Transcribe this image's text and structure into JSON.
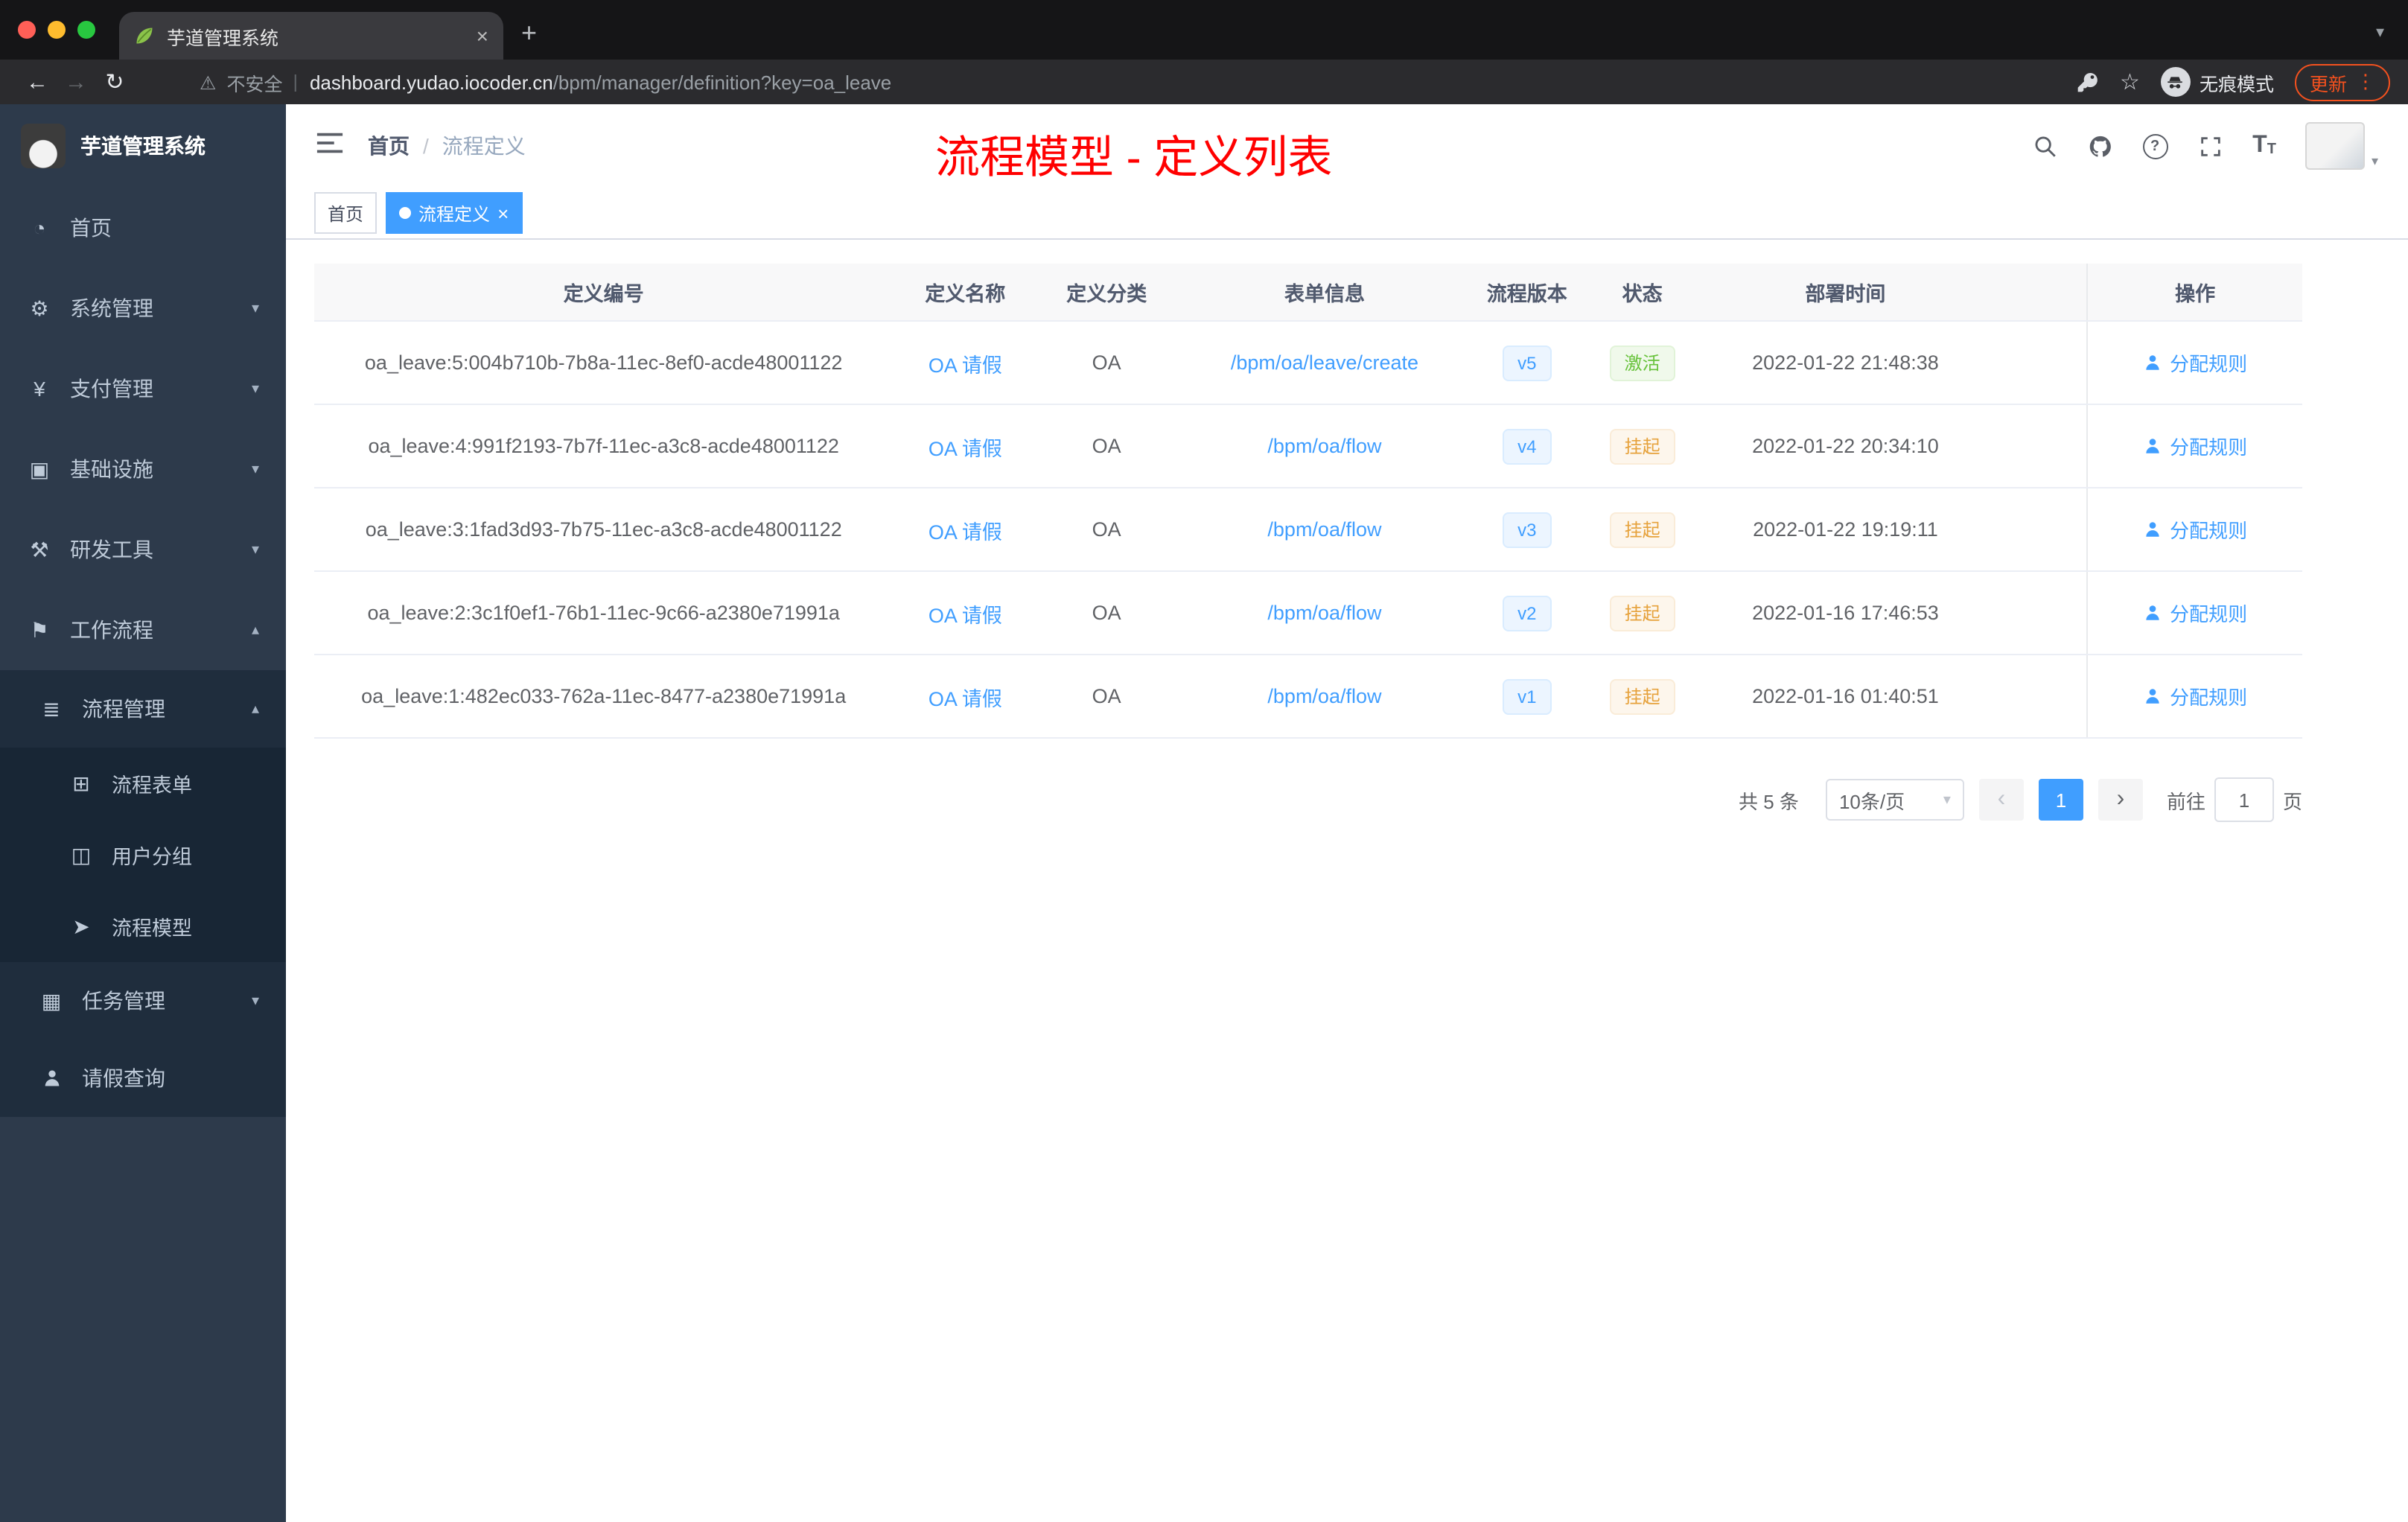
{
  "colors": {
    "accent": "#409eff",
    "success_green": "#67c23a",
    "warning_yellow": "#e6a23c",
    "annotation_red": "#ff0000",
    "update_orange": "#f4511e",
    "sidebar_bg": "#2d3a4b",
    "sidebar_sub_bg": "#1f2d3d"
  },
  "icons": {
    "back": "←",
    "forward": "→",
    "reload": "↻",
    "warning_triangle": "⚠",
    "star": "☆",
    "more_vertical": "⋮",
    "separator": "|",
    "new_tab_plus": "+",
    "tab_close": "×",
    "tabstrip_chevron": "▾",
    "chevron_down": "▾",
    "chevron_up": "▴",
    "question_mark": "?",
    "font_size_large": "T",
    "font_size_small": "T",
    "prev_arrow": "‹",
    "next_arrow": "›",
    "tag_close": "×",
    "breadcrumb_separator": "/",
    "home": "◔",
    "gear": "⚙",
    "yen": "¥",
    "infra": "▣",
    "tools": "⚒",
    "workflow": "⚑",
    "list": "≣",
    "form": "⊞",
    "users": "◫",
    "send": "➤",
    "tasks": "▦"
  },
  "browser": {
    "tab_title": "芋道管理系统",
    "security_label": "不安全",
    "url_host": "dashboard.yudao.iocoder.cn",
    "url_path": "/bpm/manager/definition?key=oa_leave",
    "incognito_label": "无痕模式",
    "update_label": "更新"
  },
  "sidebar": {
    "logo_title": "芋道管理系统",
    "items": [
      {
        "label": "首页"
      },
      {
        "label": "系统管理"
      },
      {
        "label": "支付管理"
      },
      {
        "label": "基础设施"
      },
      {
        "label": "研发工具"
      },
      {
        "label": "工作流程"
      },
      {
        "label": "流程管理"
      },
      {
        "label": "流程表单"
      },
      {
        "label": "用户分组"
      },
      {
        "label": "流程模型"
      },
      {
        "label": "任务管理"
      },
      {
        "label": "请假查询"
      }
    ]
  },
  "header": {
    "breadcrumb": [
      "首页",
      "流程定义"
    ],
    "annotation": "流程模型 - 定义列表"
  },
  "tags": {
    "home": "首页",
    "active": "流程定义"
  },
  "table": {
    "columns": [
      "定义编号",
      "定义名称",
      "定义分类",
      "表单信息",
      "流程版本",
      "状态",
      "部署时间",
      "操作"
    ],
    "rows": [
      {
        "id": "oa_leave:5:004b710b-7b8a-11ec-8ef0-acde48001122",
        "name": "OA 请假",
        "category": "OA",
        "form": "/bpm/oa/leave/create",
        "version": "v5",
        "status": "激活",
        "deploy_time": "2022-01-22 21:48:38",
        "action": "分配规则"
      },
      {
        "id": "oa_leave:4:991f2193-7b7f-11ec-a3c8-acde48001122",
        "name": "OA 请假",
        "category": "OA",
        "form": "/bpm/oa/flow",
        "version": "v4",
        "status": "挂起",
        "deploy_time": "2022-01-22 20:34:10",
        "action": "分配规则"
      },
      {
        "id": "oa_leave:3:1fad3d93-7b75-11ec-a3c8-acde48001122",
        "name": "OA 请假",
        "category": "OA",
        "form": "/bpm/oa/flow",
        "version": "v3",
        "status": "挂起",
        "deploy_time": "2022-01-22 19:19:11",
        "action": "分配规则"
      },
      {
        "id": "oa_leave:2:3c1f0ef1-76b1-11ec-9c66-a2380e71991a",
        "name": "OA 请假",
        "category": "OA",
        "form": "/bpm/oa/flow",
        "version": "v2",
        "status": "挂起",
        "deploy_time": "2022-01-16 17:46:53",
        "action": "分配规则"
      },
      {
        "id": "oa_leave:1:482ec033-762a-11ec-8477-a2380e71991a",
        "name": "OA 请假",
        "category": "OA",
        "form": "/bpm/oa/flow",
        "version": "v1",
        "status": "挂起",
        "deploy_time": "2022-01-16 01:40:51",
        "action": "分配规则"
      }
    ]
  },
  "pagination": {
    "total": "共 5 条",
    "page_size": "10条/页",
    "current_page": "1",
    "goto_label": "前往",
    "goto_value": "1",
    "unit_label": "页"
  }
}
